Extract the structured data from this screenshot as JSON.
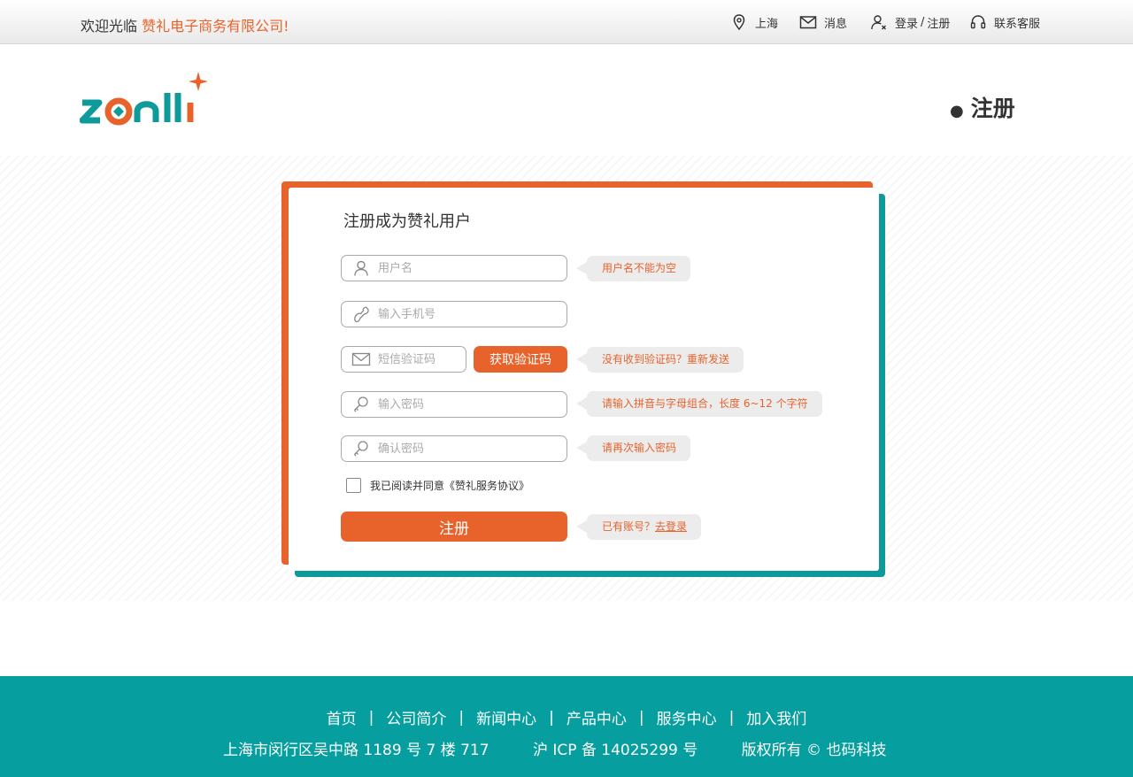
{
  "topbar": {
    "welcome": "欢迎光临",
    "company": "赞礼电子商务有限公司!",
    "location": "上海",
    "messages": "消息",
    "login": "登录",
    "login_sep": "/",
    "register": "注册",
    "service": "联系客服"
  },
  "header": {
    "page_title": "注册"
  },
  "form": {
    "title": "注册成为赞礼用户",
    "username_placeholder": "用户名",
    "phone_placeholder": "输入手机号",
    "sms_placeholder": "短信验证码",
    "sms_button": "获取验证码",
    "password_placeholder": "输入密码",
    "confirm_placeholder": "确认密码",
    "agree_text": "我已阅读并同意《赞礼服务协议》",
    "submit": "注册",
    "tips": {
      "username": "用户名不能为空",
      "sms_prefix": "没有收到验证码？",
      "sms_link": "重新发送",
      "password": "请输入拼音与字母组合，长度 6~12 个字符",
      "confirm": "请再次输入密码",
      "login_prefix": "已有账号？",
      "login_link": "去登录"
    }
  },
  "footer": {
    "nav": [
      "首页",
      "公司简介",
      "新闻中心",
      "产品中心",
      "服务中心",
      "加入我们"
    ],
    "nav_sep": "|",
    "address": "上海市闵行区吴中路 1189 号 7 楼 717",
    "icp": "沪 ICP 备 14025299 号",
    "copyright": "版权所有 © 也码科技"
  },
  "colors": {
    "accent_orange": "#e8632c",
    "accent_teal": "#0e9a9a",
    "footer_bg": "#069e9e"
  },
  "icons": {
    "location": "location-pin-icon",
    "messages": "envelope-icon",
    "login": "user-icon",
    "service": "headset-icon",
    "username": "user-icon",
    "phone": "phone-icon",
    "sms": "envelope-icon",
    "password": "key-icon"
  }
}
